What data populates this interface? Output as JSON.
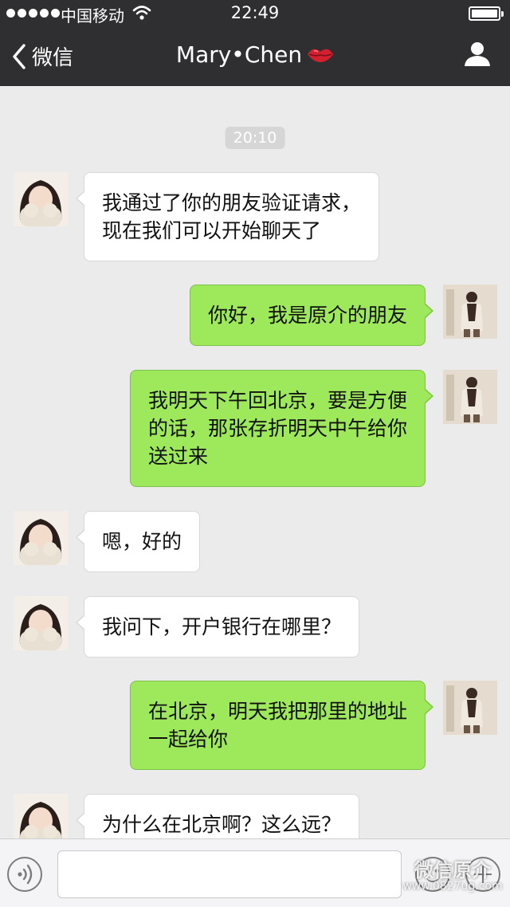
{
  "status_bar": {
    "carrier": "中国移动",
    "time": "22:49"
  },
  "nav": {
    "back_label": "微信",
    "title": "Mary•Chen"
  },
  "chat": {
    "timestamp": "20:10",
    "messages": [
      {
        "side": "in",
        "text": "我通过了你的朋友验证请求，\n现在我们可以开始聊天了"
      },
      {
        "side": "out",
        "text": "你好，我是原介的朋友"
      },
      {
        "side": "out",
        "text": "我明天下午回北京，要是方便\n的话，那张存折明天中午给你\n送过来"
      },
      {
        "side": "in",
        "text": "嗯，好的"
      },
      {
        "side": "in",
        "text": "我问下，开户银行在哪里？"
      },
      {
        "side": "out",
        "text": "在北京，明天我把那里的地址\n一起给你"
      },
      {
        "side": "in",
        "text": "为什么在北京啊？这么远？"
      }
    ]
  },
  "input": {
    "value": "",
    "placeholder": ""
  },
  "watermark": {
    "text": "微信原介",
    "url": "www.0827ug.com"
  },
  "colors": {
    "bar_bg": "#2f2f31",
    "chat_bg": "#ebebeb",
    "bubble_out": "#9ee85c",
    "bubble_in": "#ffffff",
    "lips": "#d32030"
  }
}
